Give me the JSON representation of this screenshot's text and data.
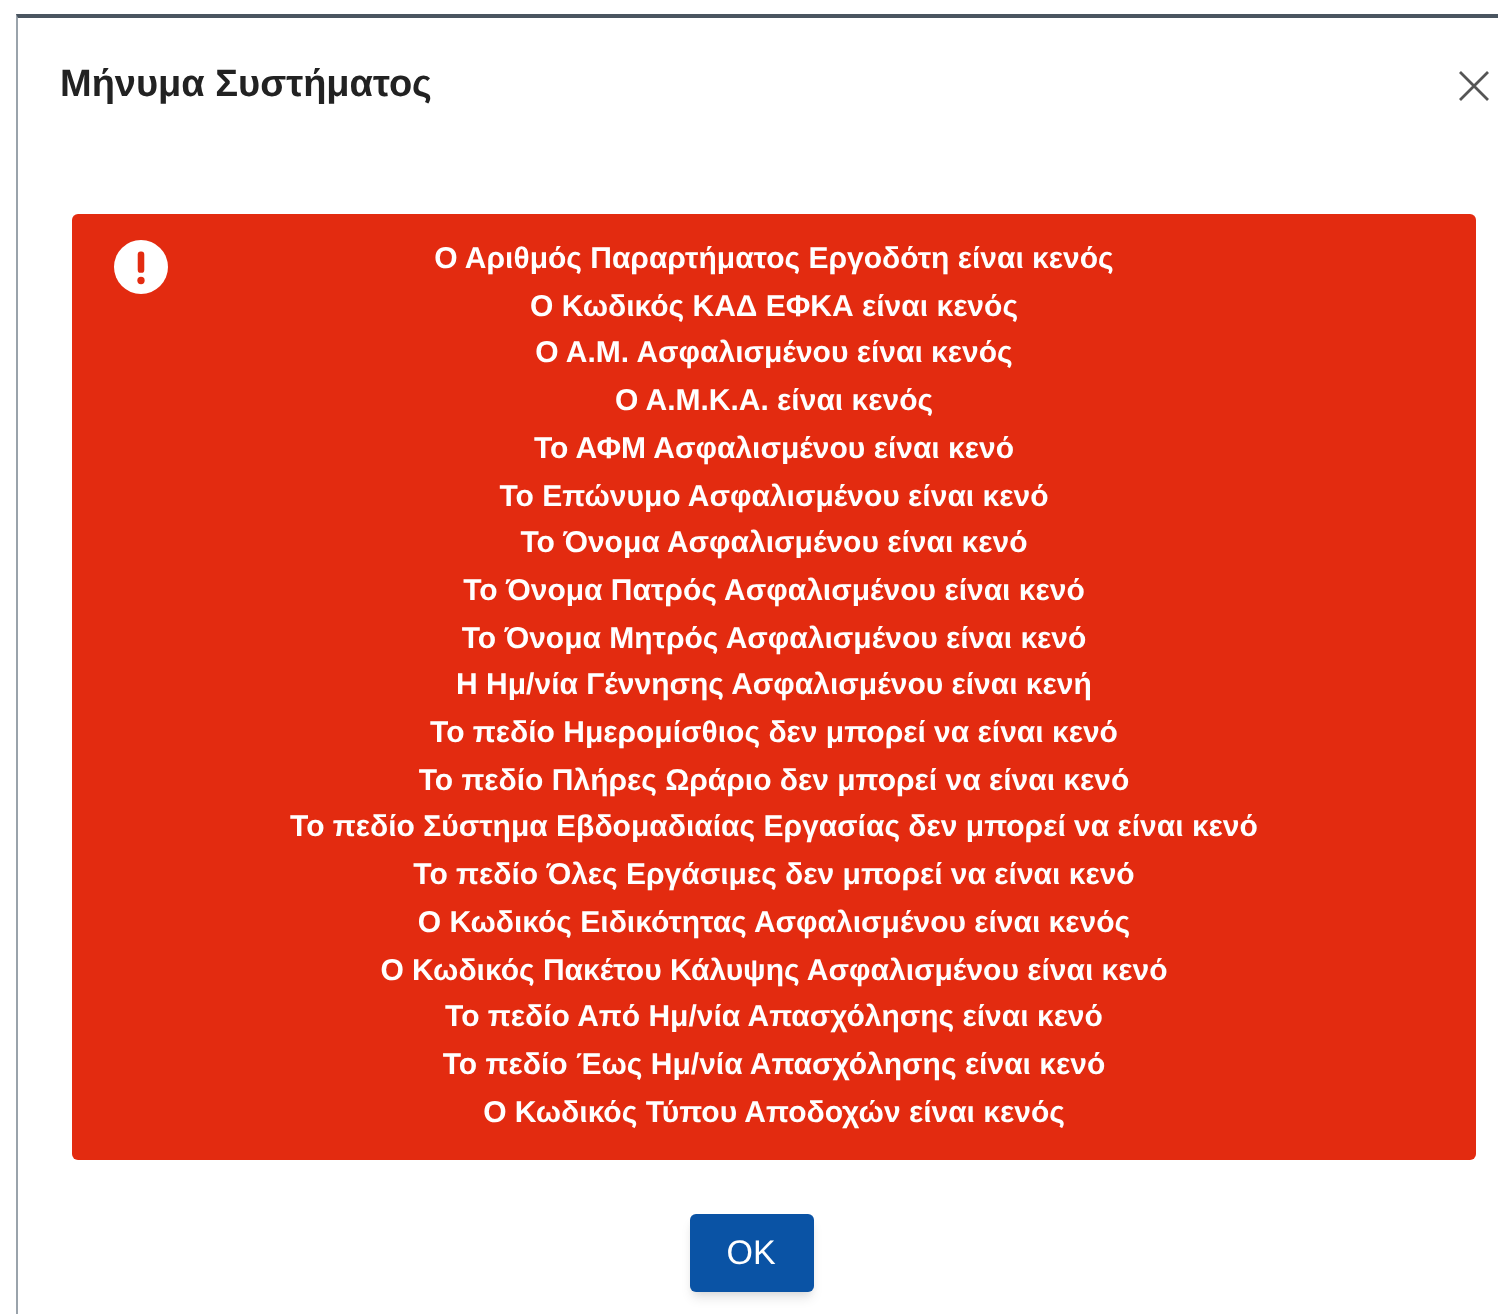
{
  "dialog": {
    "title": "Μήνυμα Συστήματος",
    "messages": [
      "Ο Αριθμός Παραρτήματος Εργοδότη είναι κενός",
      "Ο Κωδικός ΚΑΔ ΕΦΚΑ είναι κενός",
      "Ο Α.Μ. Ασφαλισμένου είναι κενός",
      "Ο Α.Μ.Κ.Α. είναι κενός",
      "Το ΑΦΜ Ασφαλισμένου είναι κενό",
      "Το Επώνυμο Ασφαλισμένου είναι κενό",
      "Το Όνομα Ασφαλισμένου είναι κενό",
      "Το Όνομα Πατρός Ασφαλισμένου είναι κενό",
      "Το Όνομα Μητρός Ασφαλισμένου είναι κενό",
      "Η Ημ/νία Γέννησης Ασφαλισμένου είναι κενή",
      "Το πεδίο Ημερομίσθιος δεν μπορεί να είναι κενό",
      "Το πεδίο Πλήρες Ωράριο δεν μπορεί να είναι κενό",
      "Το πεδίο Σύστημα Εβδομαδιαίας Εργασίας δεν μπορεί να είναι κενό",
      "Το πεδίο Όλες Εργάσιμες δεν μπορεί να είναι κενό",
      "Ο Κωδικός Ειδικότητας Ασφαλισμένου είναι κενός",
      "Ο Κωδικός Πακέτου Κάλυψης Ασφαλισμένου είναι κενό",
      "Το πεδίο Από Ημ/νία Απασχόλησης είναι κενό",
      "Το πεδίο Έως Ημ/νία Απασχόλησης είναι κενό",
      "Ο Κωδικός Τύπου Αποδοχών είναι κενός"
    ],
    "button": "OK"
  }
}
